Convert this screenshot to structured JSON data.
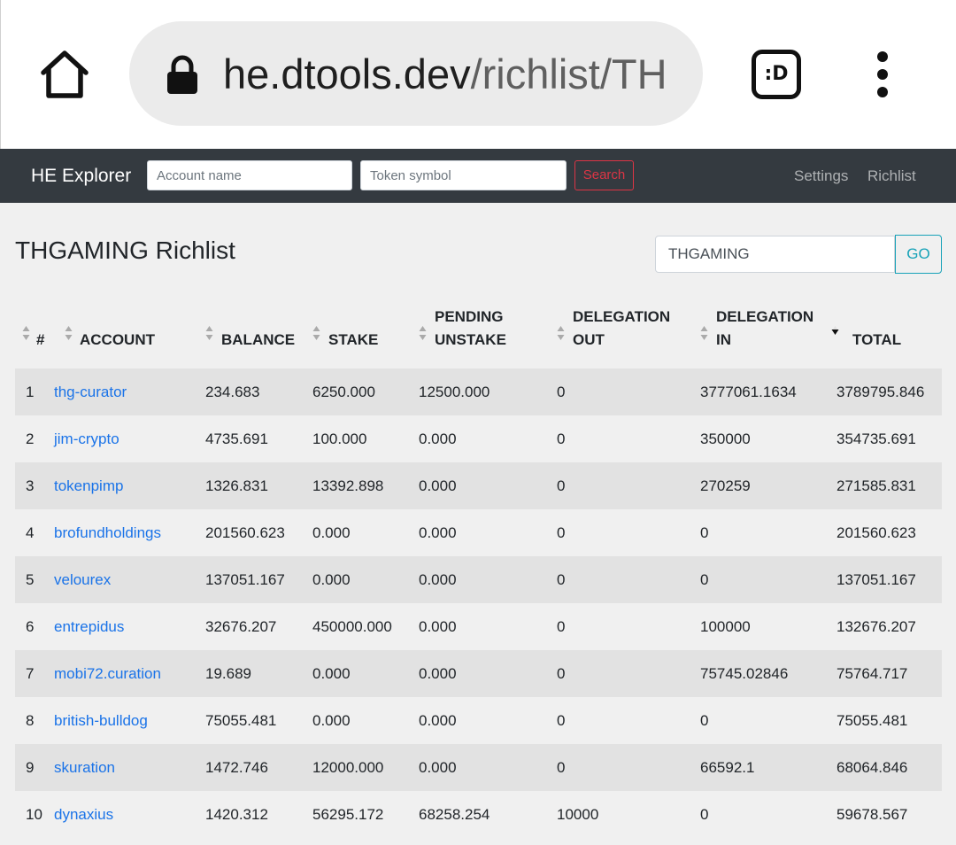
{
  "browser": {
    "url_host": "he.dtools.dev",
    "url_path": "/richlist/TH",
    "extension_label": ":D"
  },
  "navbar": {
    "brand": "HE Explorer",
    "account_placeholder": "Account name",
    "token_placeholder": "Token symbol",
    "search_label": "Search",
    "links": [
      "Settings",
      "Richlist"
    ]
  },
  "page": {
    "title": "THGAMING Richlist",
    "symbol_value": "THGAMING",
    "go_label": "GO"
  },
  "table": {
    "columns": [
      {
        "line1": "",
        "line2": "#"
      },
      {
        "line1": "",
        "line2": "ACCOUNT"
      },
      {
        "line1": "",
        "line2": "BALANCE"
      },
      {
        "line1": "",
        "line2": "STAKE"
      },
      {
        "line1": "PENDING",
        "line2": "UNSTAKE"
      },
      {
        "line1": "DELEGATION",
        "line2": "OUT"
      },
      {
        "line1": "DELEGATION",
        "line2": "IN"
      },
      {
        "line1": "",
        "line2": "TOTAL"
      }
    ],
    "sorted_column": "TOTAL",
    "rows": [
      {
        "rank": "1",
        "account": "thg-curator",
        "balance": "234.683",
        "stake": "6250.000",
        "pending_unstake": "12500.000",
        "delegation_out": "0",
        "delegation_in": "3777061.1634",
        "total": "3789795.846"
      },
      {
        "rank": "2",
        "account": "jim-crypto",
        "balance": "4735.691",
        "stake": "100.000",
        "pending_unstake": "0.000",
        "delegation_out": "0",
        "delegation_in": "350000",
        "total": "354735.691"
      },
      {
        "rank": "3",
        "account": "tokenpimp",
        "balance": "1326.831",
        "stake": "13392.898",
        "pending_unstake": "0.000",
        "delegation_out": "0",
        "delegation_in": "270259",
        "total": "271585.831"
      },
      {
        "rank": "4",
        "account": "brofundholdings",
        "balance": "201560.623",
        "stake": "0.000",
        "pending_unstake": "0.000",
        "delegation_out": "0",
        "delegation_in": "0",
        "total": "201560.623"
      },
      {
        "rank": "5",
        "account": "velourex",
        "balance": "137051.167",
        "stake": "0.000",
        "pending_unstake": "0.000",
        "delegation_out": "0",
        "delegation_in": "0",
        "total": "137051.167"
      },
      {
        "rank": "6",
        "account": "entrepidus",
        "balance": "32676.207",
        "stake": "450000.000",
        "pending_unstake": "0.000",
        "delegation_out": "0",
        "delegation_in": "100000",
        "total": "132676.207"
      },
      {
        "rank": "7",
        "account": "mobi72.curation",
        "balance": "19.689",
        "stake": "0.000",
        "pending_unstake": "0.000",
        "delegation_out": "0",
        "delegation_in": "75745.02846",
        "total": "75764.717"
      },
      {
        "rank": "8",
        "account": "british-bulldog",
        "balance": "75055.481",
        "stake": "0.000",
        "pending_unstake": "0.000",
        "delegation_out": "0",
        "delegation_in": "0",
        "total": "75055.481"
      },
      {
        "rank": "9",
        "account": "skuration",
        "balance": "1472.746",
        "stake": "12000.000",
        "pending_unstake": "0.000",
        "delegation_out": "0",
        "delegation_in": "66592.1",
        "total": "68064.846"
      },
      {
        "rank": "10",
        "account": "dynaxius",
        "balance": "1420.312",
        "stake": "56295.172",
        "pending_unstake": "68258.254",
        "delegation_out": "10000",
        "delegation_in": "0",
        "total": "59678.567"
      }
    ]
  },
  "colors": {
    "navbar_bg": "#343a40",
    "link": "#1a73e8",
    "search_outline": "#dc3545",
    "go_outline": "#17a2b8",
    "stripe": "#e2e2e2"
  },
  "icons": [
    "home-icon",
    "lock-icon",
    "extension-icon",
    "overflow-menu-icon",
    "sort-icon",
    "sort-desc-icon"
  ]
}
